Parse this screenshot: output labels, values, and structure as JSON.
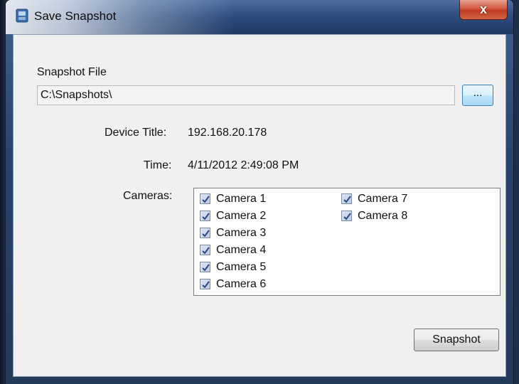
{
  "window": {
    "title": "Save Snapshot",
    "close_label": "x"
  },
  "form": {
    "snapshot_file_label": "Snapshot File",
    "snapshot_file_value": "C:\\Snapshots\\",
    "browse_label": "...",
    "device_title_label": "Device Title:",
    "device_title_value": "192.168.20.178",
    "time_label": "Time:",
    "time_value": "4/11/2012 2:49:08 PM",
    "cameras_label": "Cameras:",
    "cameras": [
      {
        "label": "Camera 1",
        "checked": true
      },
      {
        "label": "Camera 2",
        "checked": true
      },
      {
        "label": "Camera 3",
        "checked": true
      },
      {
        "label": "Camera 4",
        "checked": true
      },
      {
        "label": "Camera 5",
        "checked": true
      },
      {
        "label": "Camera 6",
        "checked": true
      },
      {
        "label": "Camera 7",
        "checked": true
      },
      {
        "label": "Camera 8",
        "checked": true
      }
    ],
    "snapshot_button": "Snapshot"
  },
  "icons": {
    "app": "app-icon",
    "checkmark": "checkmark-icon"
  },
  "colors": {
    "checkmark": "#2a4c8f",
    "close_button": "#c8462c"
  }
}
